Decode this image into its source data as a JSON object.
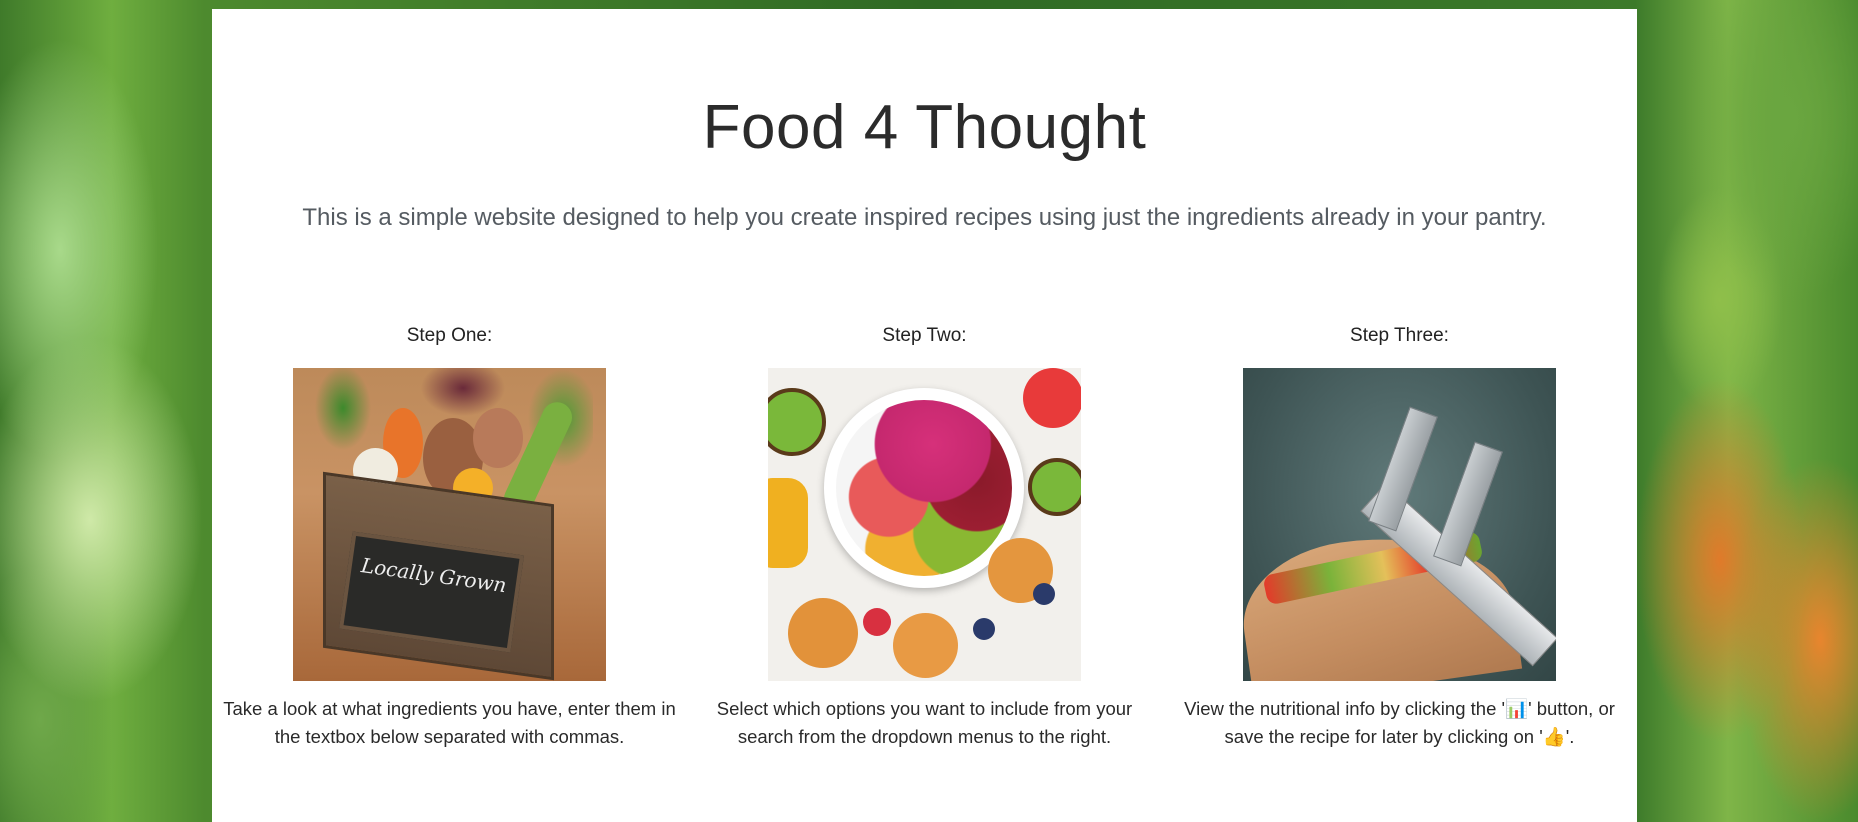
{
  "header": {
    "title": "Food 4 Thought",
    "lead": "This is a simple website designed to help you create inspired recipes using just the ingredients already in your pantry."
  },
  "steps": [
    {
      "heading": "Step One:",
      "image_icon": "vegetable-crate-photo",
      "chalk_text": "Locally Grown",
      "text": "Take a look at what ingredients you have, enter them in the textbox below separated with commas."
    },
    {
      "heading": "Step Two:",
      "image_icon": "smoothie-bowl-photo",
      "text": "Select which options you want to include from your search from the dropdown menus to the right."
    },
    {
      "heading": "Step Three:",
      "image_icon": "sandwich-caliper-photo",
      "text": "View the nutritional info by clicking the '📊' button, or save the recipe for later by clicking on '👍'."
    }
  ]
}
